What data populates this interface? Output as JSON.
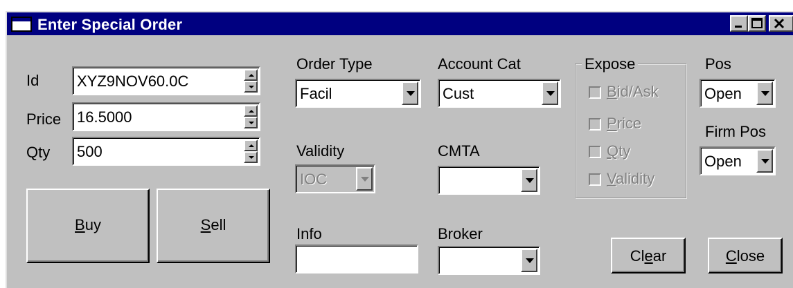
{
  "window": {
    "title": "Enter Special Order"
  },
  "fields": {
    "id": {
      "label": "Id",
      "value": "XYZ9NOV60.0C"
    },
    "price": {
      "label": "Price",
      "value": "16.5000"
    },
    "qty": {
      "label": "Qty",
      "value": "500"
    }
  },
  "buttons": {
    "buy": {
      "accel": "B",
      "rest": "uy"
    },
    "sell": {
      "accel": "S",
      "rest": "ell"
    },
    "clear": {
      "pre": "Cl",
      "accel": "e",
      "post": "ar"
    },
    "close": {
      "accel": "C",
      "rest": "lose"
    }
  },
  "order_type": {
    "label": "Order Type",
    "value": "Facil"
  },
  "account_cat": {
    "label": "Account Cat",
    "value": "Cust"
  },
  "validity": {
    "label": "Validity",
    "value": "IOC"
  },
  "cmta": {
    "label": "CMTA",
    "value": ""
  },
  "info": {
    "label": "Info",
    "value": ""
  },
  "broker": {
    "label": "Broker",
    "value": ""
  },
  "expose": {
    "label": "Expose",
    "options": [
      {
        "accel": "B",
        "rest": "id/Ask",
        "checked": false
      },
      {
        "accel": "P",
        "rest": "rice",
        "checked": false
      },
      {
        "accel": "Q",
        "rest": "ty",
        "checked": false
      },
      {
        "accel": "V",
        "rest": "alidity",
        "checked": false
      }
    ]
  },
  "pos": {
    "label": "Pos",
    "value": "Open"
  },
  "firm_pos": {
    "label": "Firm Pos",
    "value": "Open"
  },
  "icons": {
    "window": "window-icon",
    "minimize": "minimize-icon",
    "maximize": "maximize-icon",
    "close": "close-icon"
  },
  "colors": {
    "titlebar": "#000080",
    "face": "#c0c0c0"
  }
}
